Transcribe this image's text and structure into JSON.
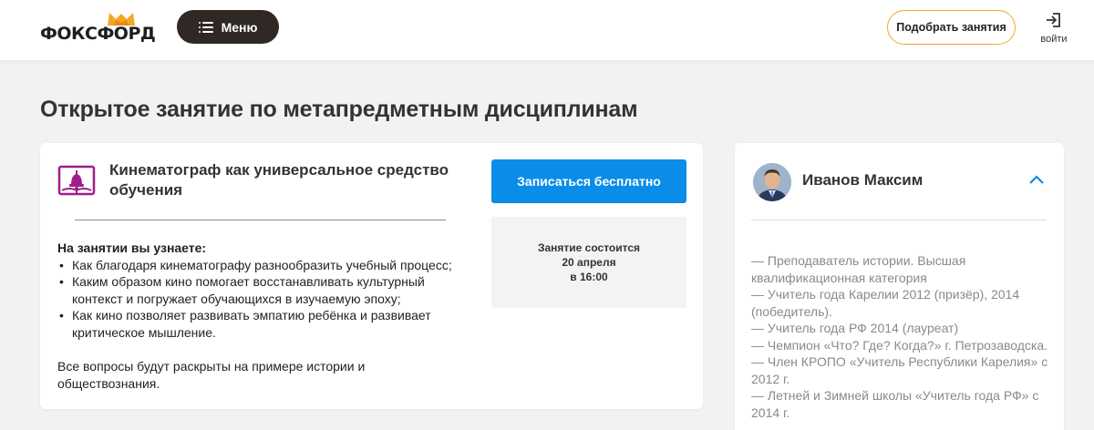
{
  "header": {
    "logo_text": "ФОКСФОРД",
    "menu_label": "Меню",
    "pick_label": "Подобрать занятия",
    "login_label": "войти"
  },
  "page": {
    "title": "Открытое занятие по метапредметным дисциплинам"
  },
  "lesson": {
    "title": "Кинематограф как универсальное средство обучения",
    "learn_heading": "На занятии вы узнаете:",
    "learn_items": [
      "Как благодаря кинематографу разнообразить учебный процесс;",
      "Каким образом кино помогает восстанавливать культурный контекст и погружает обучающихся в изучаемую эпоху;",
      "Как кино позволяет развивать эмпатию ребёнка и развивает критическое мышление."
    ],
    "summary": "Все вопросы будут раскрыты на примере истории и обществознания.",
    "signup_label": "Записаться бесплатно",
    "schedule": {
      "line1": "Занятие состоится",
      "line2": "20 апреля",
      "line3": "в 16:00"
    }
  },
  "teacher": {
    "name": "Иванов Максим",
    "bio": [
      "— Преподаватель истории. Высшая квалификационная категория",
      "— Учитель года Карелии 2012 (призёр), 2014 (победитель).",
      "— Учитель года РФ 2014 (лауреат)",
      "— Чемпион «Что? Где? Когда?» г. Петрозаводска.",
      "— Член КРОПО «Учитель Республики Карелия» с 2012 г.",
      "— Летней и Зимней школы «Учитель года РФ» с 2014 г."
    ]
  },
  "colors": {
    "primary_button": "#0a8de8",
    "menu_button": "#2f2824",
    "accent_orange": "#f5a623",
    "book_icon": "#a01e8c",
    "chevron": "#0a8de8"
  },
  "icons": {
    "menu": "list-icon",
    "login": "sign-in-icon",
    "lesson": "book-bell-icon",
    "collapse": "chevron-up-icon"
  }
}
